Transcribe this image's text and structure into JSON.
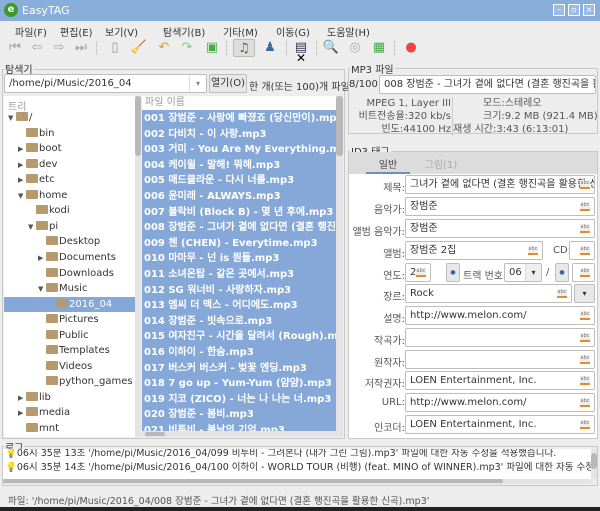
{
  "window": {
    "title": "EasyTAG",
    "minimize": "–",
    "maximize": "▫",
    "close": "×"
  },
  "menu": [
    "파일(F)",
    "편집(E)",
    "보기(V)",
    "탐색기(B)",
    "기타(M)",
    "이동(G)",
    "도움말(H)"
  ],
  "toolbar": {
    "icons": [
      "first-icon",
      "previous-icon",
      "next-icon",
      "last-icon",
      "scan-icon",
      "clean-icon",
      "undo-icon",
      "redo-icon",
      "save-icon",
      "music-icon",
      "artist-album-icon",
      "view-icon",
      "search-icon",
      "cd-icon",
      "playlist-icon",
      "stop-icon"
    ],
    "close_mark": "✕"
  },
  "browser": {
    "group_label": "탐색기",
    "path": "/home/pi/Music/2016_04",
    "open_button": "열기(O)",
    "count_text": "한 개(또는 100)개 파일",
    "tree_header": "트리",
    "file_header": "파일 이름",
    "tree": [
      {
        "label": "/",
        "depth": 0,
        "arrow": "down"
      },
      {
        "label": "bin",
        "depth": 1,
        "arrow": ""
      },
      {
        "label": "boot",
        "depth": 1,
        "arrow": "right"
      },
      {
        "label": "dev",
        "depth": 1,
        "arrow": "right"
      },
      {
        "label": "etc",
        "depth": 1,
        "arrow": "right"
      },
      {
        "label": "home",
        "depth": 1,
        "arrow": "down"
      },
      {
        "label": "kodi",
        "depth": 2,
        "arrow": ""
      },
      {
        "label": "pi",
        "depth": 2,
        "arrow": "down"
      },
      {
        "label": "Desktop",
        "depth": 3,
        "arrow": ""
      },
      {
        "label": "Documents",
        "depth": 3,
        "arrow": "right"
      },
      {
        "label": "Downloads",
        "depth": 3,
        "arrow": ""
      },
      {
        "label": "Music",
        "depth": 3,
        "arrow": "down"
      },
      {
        "label": "2016_04",
        "depth": 4,
        "arrow": "",
        "selected": true
      },
      {
        "label": "Pictures",
        "depth": 3,
        "arrow": ""
      },
      {
        "label": "Public",
        "depth": 3,
        "arrow": ""
      },
      {
        "label": "Templates",
        "depth": 3,
        "arrow": ""
      },
      {
        "label": "Videos",
        "depth": 3,
        "arrow": ""
      },
      {
        "label": "python_games",
        "depth": 3,
        "arrow": ""
      },
      {
        "label": "lib",
        "depth": 1,
        "arrow": "right"
      },
      {
        "label": "media",
        "depth": 1,
        "arrow": "right"
      },
      {
        "label": "mnt",
        "depth": 1,
        "arrow": ""
      }
    ],
    "files": [
      "001 장범준 - 사랑에 빠졌죠 (당신만이).mp3",
      "002 다비치 - 이 사랑.mp3",
      "003 거미 - You Are My Everything.mp3",
      "004 케이윌 - 말해! 뭐해.mp3",
      "005 매드클라운 - 다시 너를.mp3",
      "006 윤미래 - ALWAYS.mp3",
      "007 블락비 (Block B) - 몇 년 후에.mp3",
      "008 장범준 - 그녀가 곁에 없다면 (결혼 행진곡을 활용한 신곡).mp3",
      "009 첸 (CHEN) - Everytime.mp3",
      "010 마마무 - 넌 is 뭔들.mp3",
      "011 소녀온탑 - 같은 곳에서.mp3",
      "012 SG 워너비 - 사랑하자.mp3",
      "013 엠씨 더 맥스 - 어디에도.mp3",
      "014 장범준 - 빗속으로.mp3",
      "015 여자친구 - 시간을 달려서 (Rough).mp3",
      "016 이하이 - 한숨.mp3",
      "017 버스커 버스커 - 벚꽃 엔딩.mp3",
      "018 7 go up - Yum-Yum (얌얌).mp3",
      "019 지코 (ZICO) - 너는 나 나는 너.mp3",
      "020 장범준 - 봄비.mp3",
      "021 비투비 - 봄날의 기억.mp3"
    ]
  },
  "mp3": {
    "group_label": "MP3 파일",
    "index": "8/100:",
    "filename": "008 장범준 - 그녀가 곁에 없다면 (결혼 행진곡을 활용한 신곡).mp3",
    "info": {
      "codec": "MPEG 1, Layer III",
      "bitrate_label": "비트전송율:",
      "bitrate": "320 kb/s",
      "freq_label": "빈도:",
      "freq": "44100 Hz",
      "mode_label": "모드:",
      "mode": "스테레오",
      "size_label": "크기:",
      "size": "9.2 MB (921.4 MB)",
      "duration_label": "재생 시간:",
      "duration": "3:43 (6:13:01)"
    }
  },
  "id3": {
    "group_label": "ID3 태그",
    "tabs": [
      "일반",
      "그림(1)"
    ],
    "fields": {
      "title_label": "제목:",
      "title": "그녀가 곁에 없다면 (결혼 행진곡을 활용한 신곡)",
      "artist_label": "음악가:",
      "artist": "장범준",
      "album_artist_label": "앨범 음악가:",
      "album_artist": "장범준",
      "album_label": "앨범:",
      "album": "장범준 2집",
      "cd_label": "CD:",
      "cd": "",
      "year_label": "연도:",
      "year": "20",
      "track_label": "트랙 번호:",
      "track": "06",
      "track_sep": "/",
      "track_total": "",
      "genre_label": "장르:",
      "genre": "Rock",
      "comment_label": "설명:",
      "comment": "http://www.melon.com/",
      "composer_label": "작곡가:",
      "composer": "",
      "orig_artist_label": "원작자:",
      "orig_artist": "",
      "copyright_label": "저작권자:",
      "copyright": "LOEN Entertainment, Inc.",
      "url_label": "URL:",
      "url": "http://www.melon.com/",
      "encoder_label": "인코더:",
      "encoder": "LOEN Entertainment, Inc."
    }
  },
  "log": {
    "group_label": "로그",
    "lines": [
      "06시 35분 13초 '/home/pi/Music/2016_04/099 비투비 - 그려본다 (내가 그린 그림).mp3' 파일에 대한 자동 수정을 적용했습니다.",
      "06시 35분 14초 '/home/pi/Music/2016_04/100 이하이 - WORLD TOUR (비행) (feat. MINO of WINNER).mp3' 파일에 대한 자동 수정을 적용했습니다."
    ]
  },
  "status": "파일: '/home/pi/Music/2016_04/008 장범준 - 그녀가 곁에 없다면 (결혼 행진곡을 활용한 신곡).mp3'",
  "colors": {
    "selection": "#86a8d8",
    "titlebar": "#8aaedc"
  }
}
